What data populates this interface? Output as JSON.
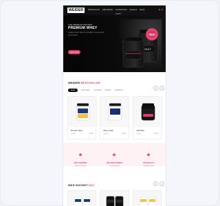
{
  "app": {
    "title": ""
  },
  "nav": {
    "logo_text": "WEIDER",
    "items": [
      "PRODUCTS",
      "PROTEINS",
      "NUTRITION",
      "GOALS",
      "SALE"
    ],
    "sub": "CART"
  },
  "hero": {
    "kicker": "THE PREMIUM PROTEIN",
    "title": "PREMIUM WHEY",
    "copy": "Quality protein blend for strength, recovery and performance.",
    "cta": "SHOP NOW",
    "badge": "NEW",
    "product_label": "WHEY"
  },
  "section1": {
    "title_dark": "WEIDER",
    "title_accent": "BESTSELLER",
    "tabs": [
      "ALLE",
      "PROTEINE",
      "VITAMINE",
      "RIEGEL",
      "ZUBEHÖR"
    ],
    "prev_icon": "chevron-left-icon",
    "next_icon": "chevron-right-icon"
  },
  "bestsellers": [
    {
      "name": "Premium Whey",
      "meta": "Protein",
      "price": "29,90"
    },
    {
      "name": "Whey Isolate",
      "meta": "Protein",
      "price": "34,90"
    },
    {
      "name": "Gold Whey",
      "meta": "Protein",
      "price": "39,90"
    }
  ],
  "benefits": [
    {
      "title": "FAST SHIPPING",
      "copy": "Schnelle Lieferung"
    },
    {
      "title": "SECURE PAYMENT",
      "copy": "Sichere Zahlung"
    },
    {
      "title": "TOP QUALITY",
      "copy": "Geprüfte Qualität"
    }
  ],
  "section2": {
    "title_dark": "WAS SUCHST",
    "title_accent": "DU?",
    "prev_icon": "chevron-left-icon",
    "next_icon": "chevron-right-icon"
  },
  "colors": {
    "accent": "#e63a6a",
    "dark": "#111111",
    "benefit_bg": "#fff2f5"
  }
}
